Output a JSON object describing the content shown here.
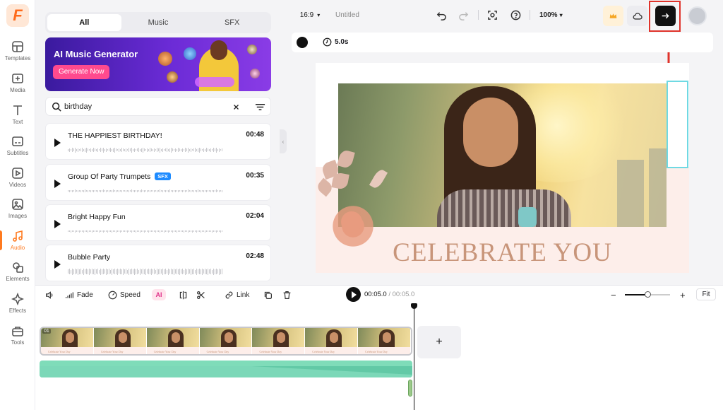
{
  "app": {
    "logo_letter": "F",
    "accent": "#ff7a1f"
  },
  "sidebar": {
    "items": [
      {
        "label": "Templates",
        "icon": "templates-icon"
      },
      {
        "label": "Media",
        "icon": "media-icon"
      },
      {
        "label": "Text",
        "icon": "text-icon"
      },
      {
        "label": "Subtitles",
        "icon": "subtitles-icon"
      },
      {
        "label": "Videos",
        "icon": "videos-icon"
      },
      {
        "label": "Images",
        "icon": "images-icon"
      },
      {
        "label": "Audio",
        "icon": "audio-icon",
        "active": true
      },
      {
        "label": "Elements",
        "icon": "elements-icon"
      },
      {
        "label": "Effects",
        "icon": "effects-icon"
      },
      {
        "label": "Tools",
        "icon": "tools-icon"
      }
    ]
  },
  "panel": {
    "tabs": [
      {
        "label": "All",
        "active": true
      },
      {
        "label": "Music",
        "active": false
      },
      {
        "label": "SFX",
        "active": false
      }
    ],
    "banner": {
      "title": "AI Music Generator",
      "button": "Generate Now"
    },
    "search": {
      "value": "birthday"
    },
    "tracks": [
      {
        "name": "THE HAPPIEST BIRTHDAY!",
        "duration": "00:48",
        "badge": ""
      },
      {
        "name": "Group Of Party Trumpets",
        "duration": "00:35",
        "badge": "SFX"
      },
      {
        "name": "Bright Happy Fun",
        "duration": "02:04",
        "badge": ""
      },
      {
        "name": "Bubble Party",
        "duration": "02:48",
        "badge": ""
      }
    ]
  },
  "topbar": {
    "aspect": "16:9",
    "project_name": "Untitled",
    "zoom": "100%"
  },
  "properties": {
    "duration": "5.0s",
    "color": "#111111"
  },
  "canvas": {
    "headline": "CELEBRATE YOU"
  },
  "timeline_toolbar": {
    "fade": "Fade",
    "speed": "Speed",
    "ai": "AI",
    "link": "Link",
    "current_time": "00:05.0",
    "total_time": "00:05.0",
    "fit": "Fit",
    "zoom_level": 0.5
  },
  "timeline": {
    "clip_index": "01",
    "thumb_caption": "Celebrate Your Day",
    "thumb_count": 7
  }
}
